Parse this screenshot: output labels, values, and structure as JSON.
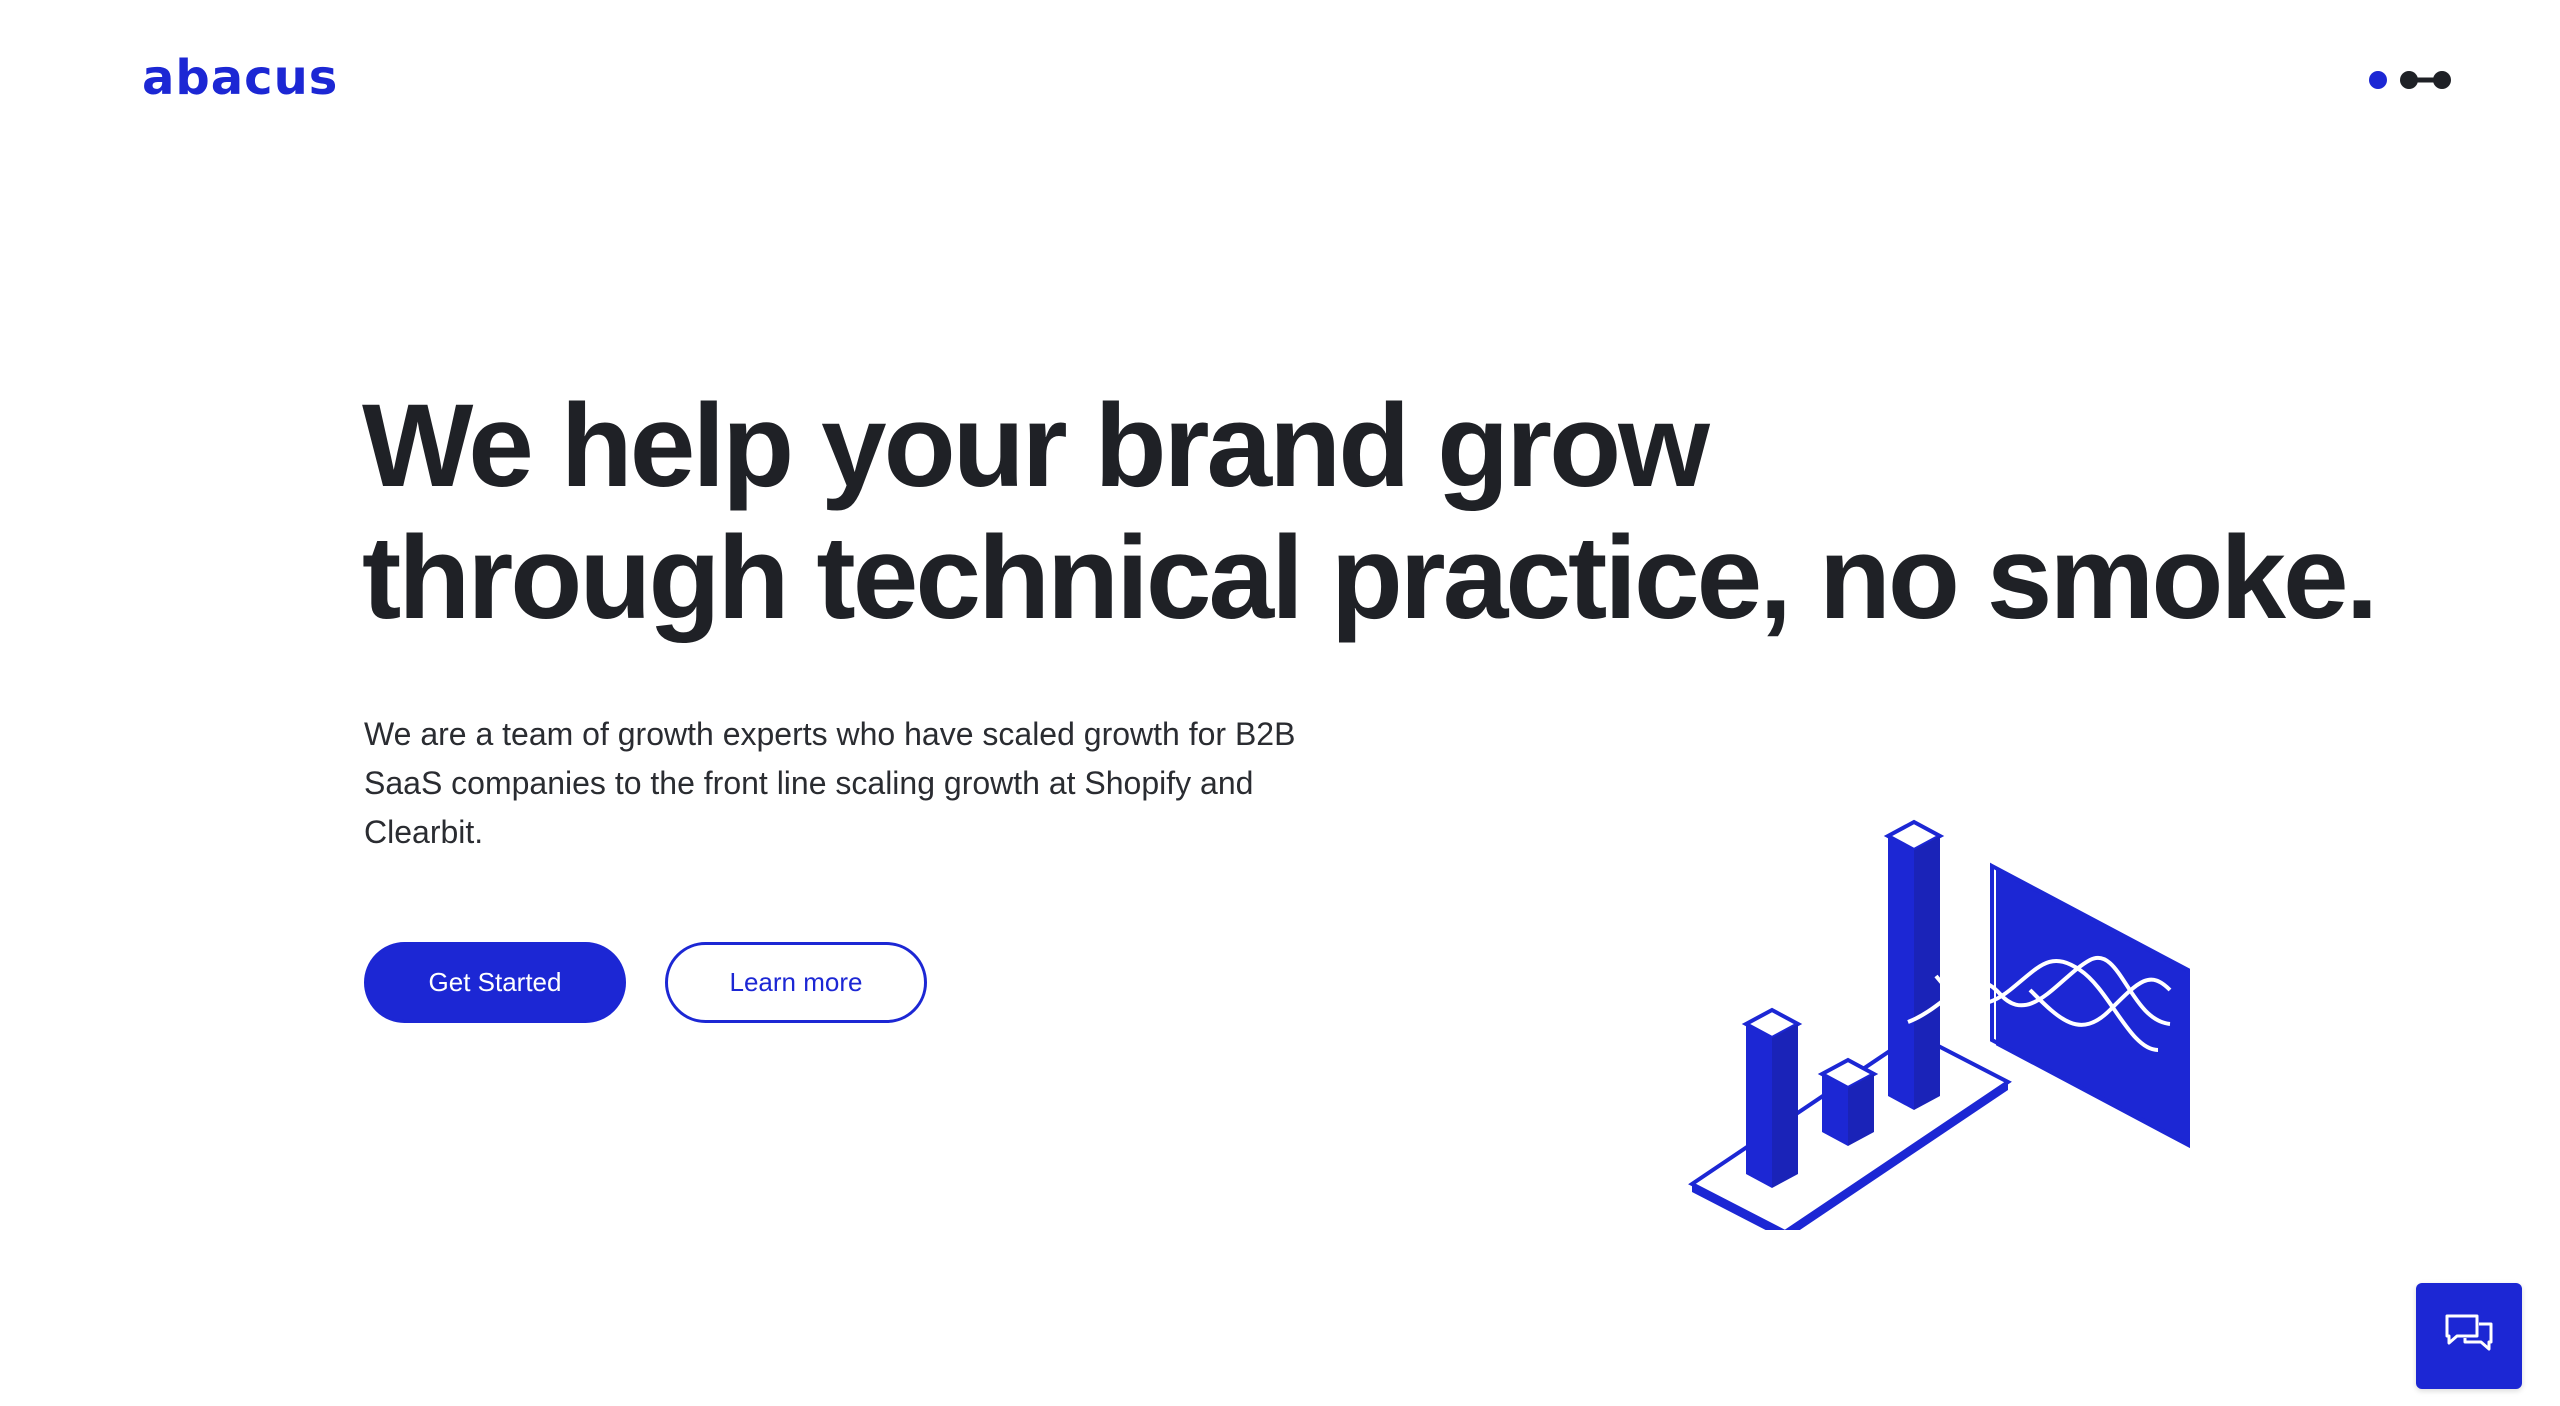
{
  "header": {
    "logo_text": "abacus",
    "menu_icon": "menu-dots-icon"
  },
  "hero": {
    "title_line1": "We help your brand grow",
    "title_line2": "through technical practice, no smoke.",
    "description": "We are a team of growth experts who have scaled growth for B2B SaaS companies to the front line scaling growth at Shopify and Clearbit.",
    "primary_button": "Get Started",
    "secondary_button": "Learn more",
    "illustration_icon": "isometric-bar-chart-illustration"
  },
  "chat": {
    "icon": "chat-bubbles-icon"
  },
  "colors": {
    "brand": "#1c27d4",
    "text": "#1f2126",
    "background": "#ffffff"
  }
}
